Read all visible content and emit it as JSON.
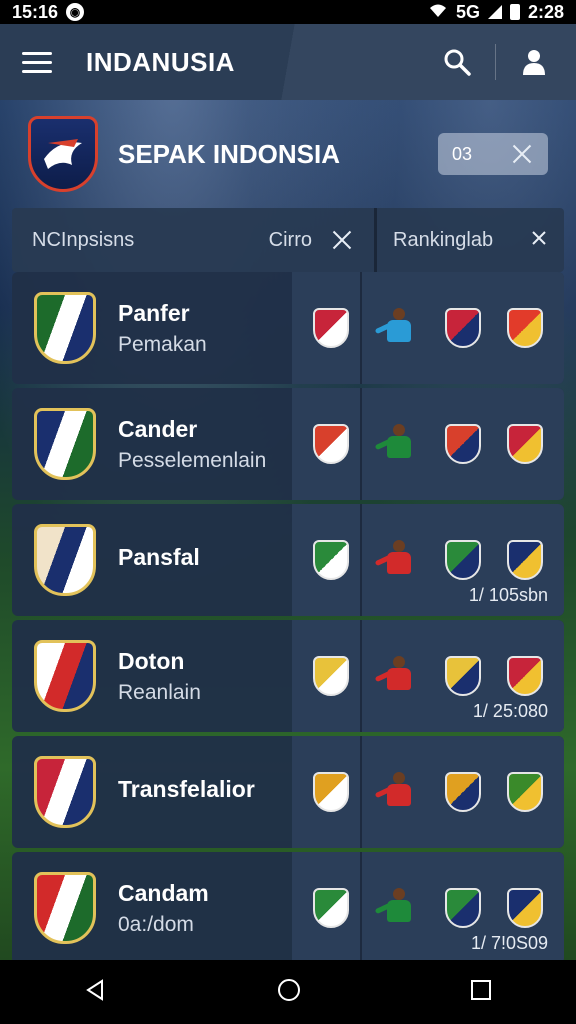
{
  "status_bar": {
    "time": "15:16",
    "signal_text": "5G",
    "right_time": "2:28"
  },
  "app_bar": {
    "title": "INDANUSIA"
  },
  "header": {
    "title": "SEPAK INDONSIA",
    "chip_value": "03"
  },
  "filter": {
    "left_label": "NCInpsisns",
    "left_sub": "Cirro",
    "right_label": "Rankinglab"
  },
  "cards": [
    {
      "name": "Panfer",
      "sub": "Pemakan",
      "meta": "",
      "crest_colors": [
        "#1d6b2b",
        "#ffffff",
        "#1a2f6e"
      ],
      "player_color": "#2a9bd6",
      "badges": [
        "#c7243a",
        "#e23b2a"
      ]
    },
    {
      "name": "Cander",
      "sub": "Pesselemenlain",
      "meta": "",
      "crest_colors": [
        "#1a2f6e",
        "#ffffff",
        "#1d6b2b"
      ],
      "player_color": "#1e8a3a",
      "badges": [
        "#d8402c",
        "#c7243a"
      ]
    },
    {
      "name": "Pansfal",
      "sub": "",
      "meta": "1/ 105sbn",
      "crest_colors": [
        "#f1e3c9",
        "#1a2f6e",
        "#ffffff"
      ],
      "player_color": "#d22a2a",
      "badges": [
        "#2a8a3a",
        "#1a2f6e"
      ]
    },
    {
      "name": "Doton",
      "sub": "Reanlain",
      "meta": "1/ 25:080",
      "crest_colors": [
        "#ffffff",
        "#d22a2a",
        "#1a2f6e"
      ],
      "player_color": "#d22a2a",
      "badges": [
        "#e8c23a",
        "#c7243a"
      ]
    },
    {
      "name": "Transfelalior",
      "sub": "",
      "meta": "",
      "crest_colors": [
        "#c7243a",
        "#ffffff",
        "#1a2f6e"
      ],
      "player_color": "#d22a2a",
      "badges": [
        "#e0a020",
        "#3a8a2a"
      ]
    },
    {
      "name": "Candam",
      "sub": "0a:/dom",
      "meta": "1/ 7!0S09",
      "crest_colors": [
        "#d22a2a",
        "#ffffff",
        "#1d6b2b"
      ],
      "player_color": "#1e8a3a",
      "badges": [
        "#2a8a3a",
        "#1a2f6e"
      ]
    }
  ]
}
